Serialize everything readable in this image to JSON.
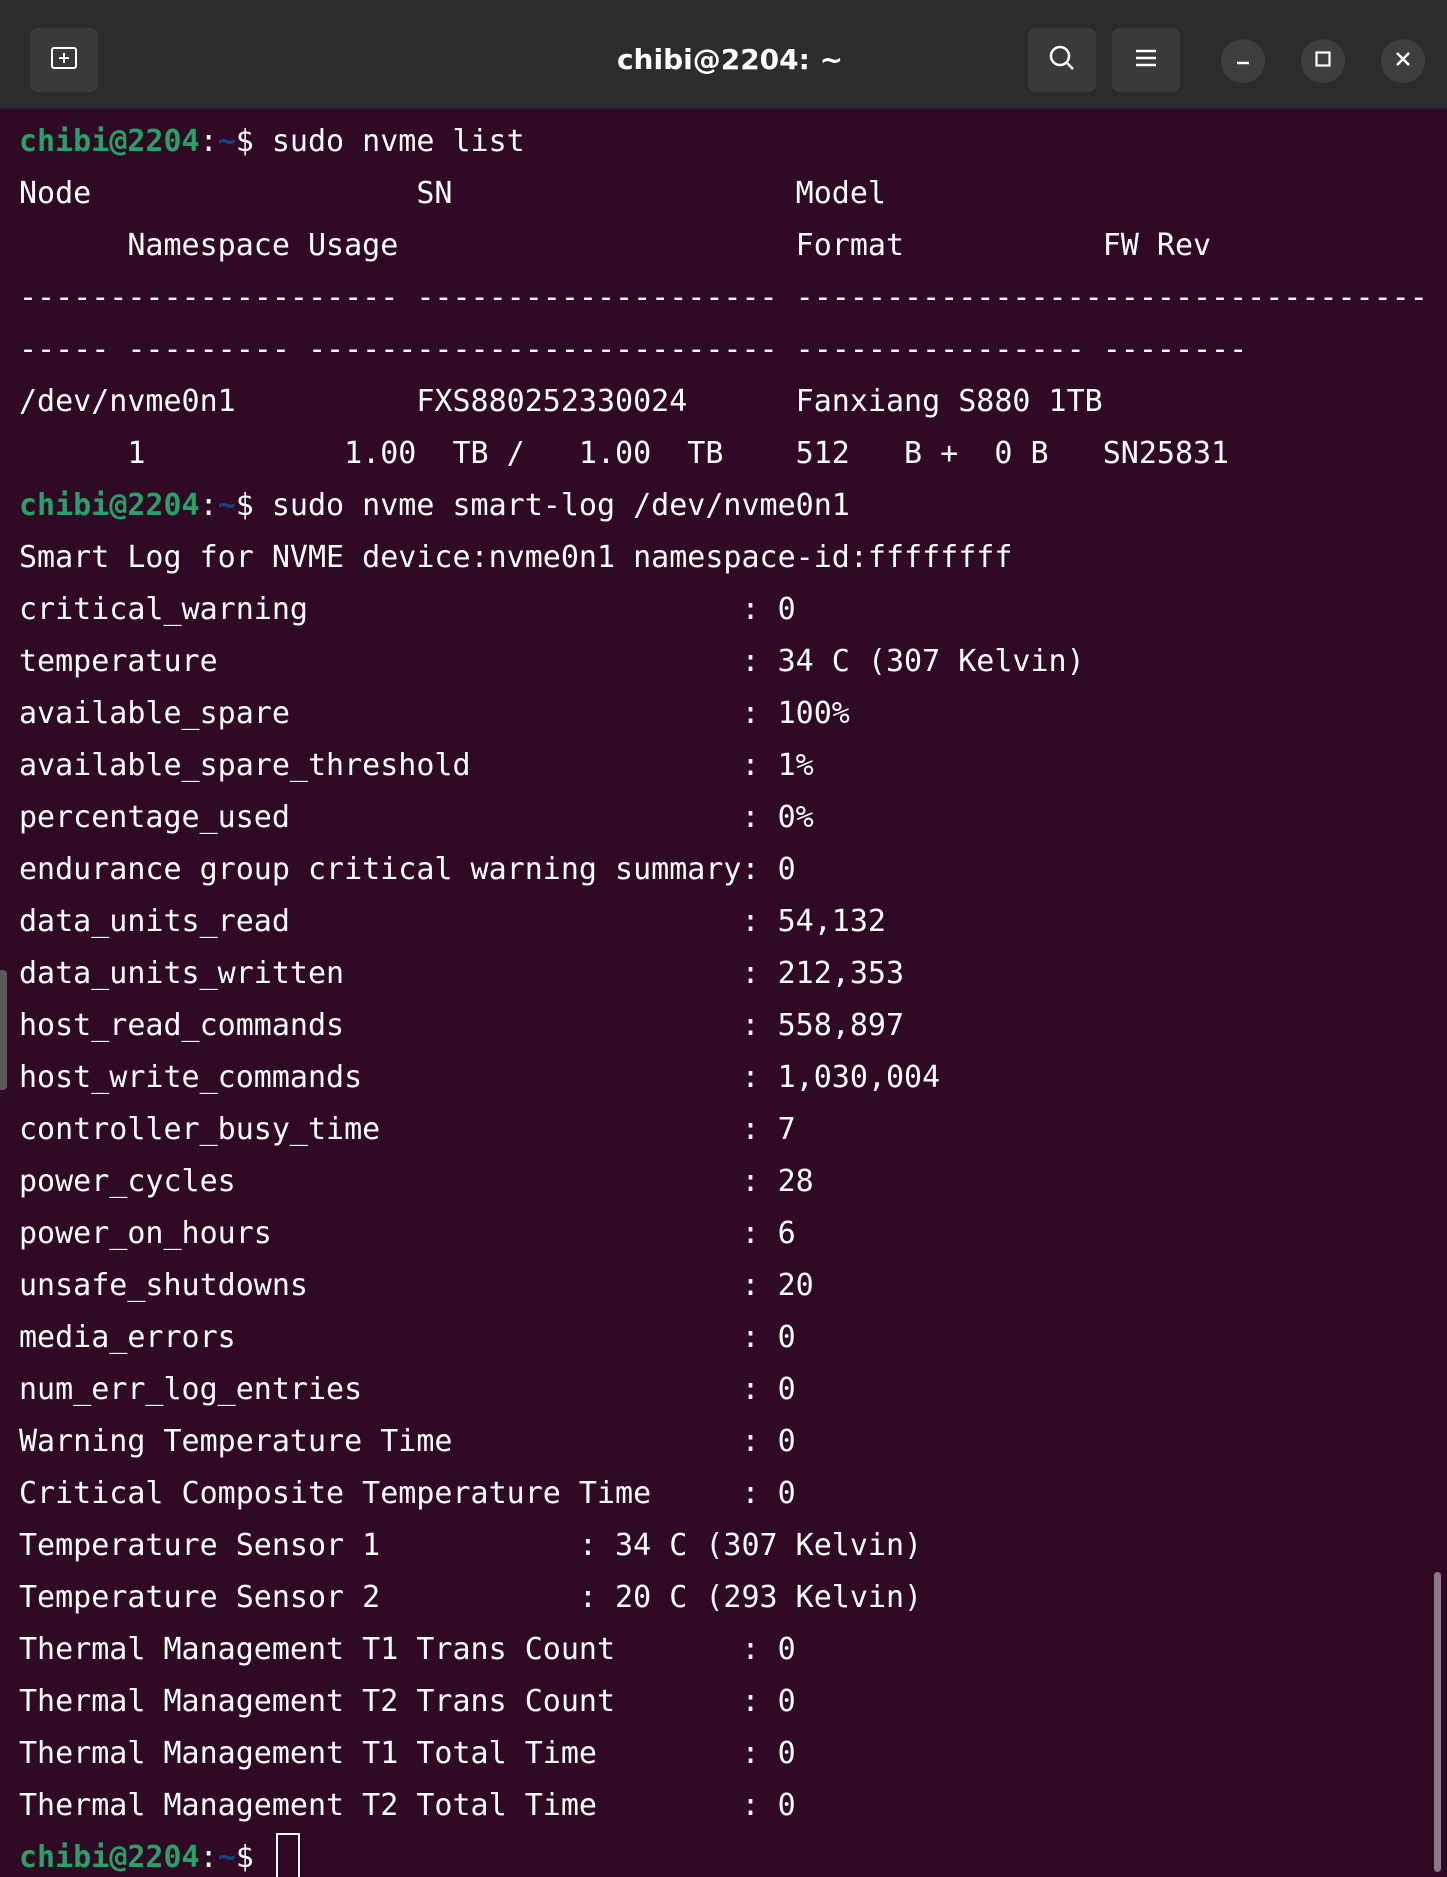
{
  "window": {
    "title": "chibi@2204: ~",
    "new_tab_icon": "new-tab-icon",
    "search_icon": "search-icon",
    "menu_icon": "hamburger-menu-icon",
    "minimize_icon": "minimize-icon",
    "maximize_icon": "maximize-icon",
    "close_icon": "close-icon"
  },
  "prompt": {
    "user": "chibi@2204",
    "sep": ":",
    "path": "~",
    "dollar": "$ "
  },
  "commands": {
    "c1": "sudo nvme list",
    "c2": "sudo nvme smart-log /dev/nvme0n1"
  },
  "output": {
    "list_header1": "Node                  SN                   Model",
    "list_header2": "      Namespace Usage                      Format           FW Rev",
    "list_sep1": "--------------------- -------------------- -----------------------------------",
    "list_sep2": "----- --------- -------------------------- ---------------- --------",
    "list_row1": "/dev/nvme0n1          FXS880252330024      Fanxiang S880 1TB",
    "list_row2": "      1           1.00  TB /   1.00  TB    512   B +  0 B   SN25831",
    "smart_title": "Smart Log for NVME device:nvme0n1 namespace-id:ffffffff"
  },
  "smart": [
    "critical_warning                        : 0",
    "temperature                             : 34 C (307 Kelvin)",
    "available_spare                         : 100%",
    "available_spare_threshold               : 1%",
    "percentage_used                         : 0%",
    "endurance group critical warning summary: 0",
    "data_units_read                         : 54,132",
    "data_units_written                      : 212,353",
    "host_read_commands                      : 558,897",
    "host_write_commands                     : 1,030,004",
    "controller_busy_time                    : 7",
    "power_cycles                            : 28",
    "power_on_hours                          : 6",
    "unsafe_shutdowns                        : 20",
    "media_errors                            : 0",
    "num_err_log_entries                     : 0",
    "Warning Temperature Time                : 0",
    "Critical Composite Temperature Time     : 0",
    "Temperature Sensor 1           : 34 C (307 Kelvin)",
    "Temperature Sensor 2           : 20 C (293 Kelvin)",
    "Thermal Management T1 Trans Count       : 0",
    "Thermal Management T2 Trans Count       : 0",
    "Thermal Management T1 Total Time        : 0",
    "Thermal Management T2 Total Time        : 0"
  ]
}
